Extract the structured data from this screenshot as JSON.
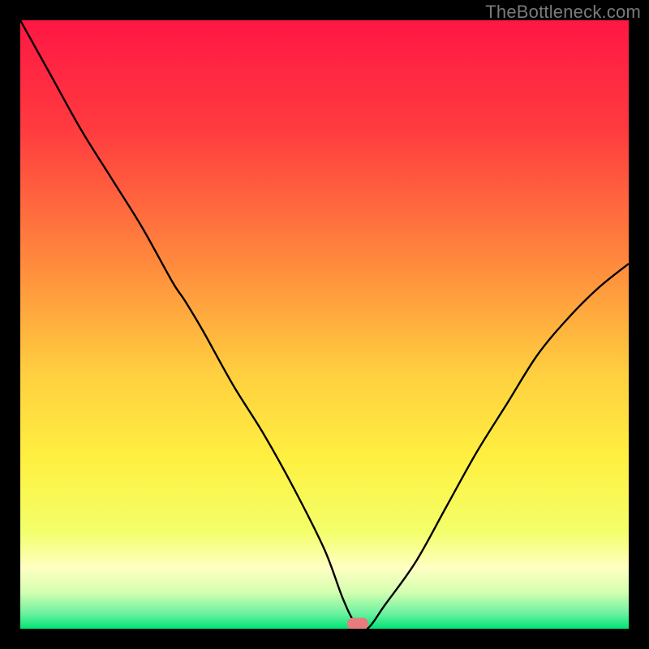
{
  "watermark": "TheBottleneck.com",
  "marker": {
    "x_pct": 55.5,
    "y_pct": 0
  },
  "colors": {
    "gradient_stops": [
      {
        "offset": 0,
        "color": "#ff1744"
      },
      {
        "offset": 0.18,
        "color": "#ff3b3f"
      },
      {
        "offset": 0.4,
        "color": "#ff8a3d"
      },
      {
        "offset": 0.58,
        "color": "#ffcf3f"
      },
      {
        "offset": 0.72,
        "color": "#fff040"
      },
      {
        "offset": 0.84,
        "color": "#f3ff6a"
      },
      {
        "offset": 0.9,
        "color": "#ffffc2"
      },
      {
        "offset": 0.94,
        "color": "#d4ffb0"
      },
      {
        "offset": 0.975,
        "color": "#6cf2a0"
      },
      {
        "offset": 1.0,
        "color": "#00e576"
      }
    ],
    "curve": "#000000",
    "frame": "#000000",
    "marker": "#e77c7e"
  },
  "chart_data": {
    "type": "line",
    "title": "",
    "xlabel": "",
    "ylabel": "",
    "xlim": [
      0,
      100
    ],
    "ylim": [
      0,
      100
    ],
    "legend": false,
    "grid": false,
    "series": [
      {
        "name": "bottleneck-curve",
        "x": [
          0,
          5,
          10,
          15,
          20,
          25,
          27,
          30,
          35,
          40,
          45,
          50,
          53,
          55,
          57,
          60,
          65,
          70,
          75,
          80,
          85,
          90,
          95,
          100
        ],
        "y": [
          100,
          91,
          82,
          74,
          66,
          57,
          54,
          49,
          40,
          32,
          23,
          13,
          5,
          1,
          0,
          4,
          11,
          20,
          29,
          37,
          45,
          51,
          56,
          60
        ]
      }
    ],
    "annotations": [
      {
        "type": "marker",
        "x": 55.5,
        "y": 0,
        "shape": "rounded-rect",
        "color": "#e77c7e"
      }
    ]
  }
}
